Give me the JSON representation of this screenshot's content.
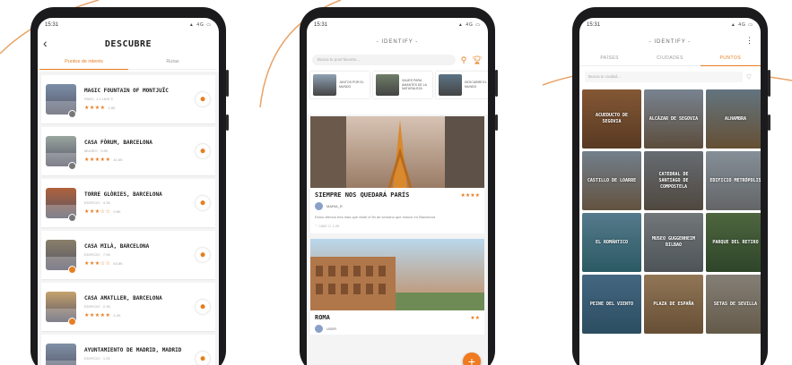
{
  "colors": {
    "accent": "#e67e22",
    "phone_body": "#1b1b1d",
    "list_bg": "#f4f4f4"
  },
  "phone1": {
    "time": "15:31",
    "status_icons": "▲ 4G ▭",
    "title": "DESCUBRE",
    "tabs": [
      {
        "label": "Puntos de interés",
        "active": true
      },
      {
        "label": "Rutas",
        "active": false
      }
    ],
    "items": [
      {
        "name": "MAGIC FOUNTAIN OF MONTJUÏC",
        "sub": "PARC, 1.2 LIKE 5",
        "stars": "★★★★",
        "count": "2.85",
        "thumb": "#7c8fa8",
        "badge": "gray"
      },
      {
        "name": "CASA FÒRUM, BARCELONA",
        "sub": "MUSEO · 9.8K",
        "stars": "★★★★★",
        "count": "41.6K",
        "thumb": "#9aa6a0",
        "badge": "gray"
      },
      {
        "name": "TORRE GLÒRIES, BARCELONA",
        "sub": "EDIFICIO · 4.3K",
        "stars": "★★★☆☆",
        "count": "9.8K",
        "thumb": "#b0623c",
        "badge": "gray"
      },
      {
        "name": "CASA MILÀ, BARCELONA",
        "sub": "EDIFICIO · 7.9K",
        "stars": "★★★☆☆",
        "count": "63.8K",
        "thumb": "#8a7f68",
        "badge": "orange"
      },
      {
        "name": "CASA AMATLLER, BARCELONA",
        "sub": "EDIFICIO · 2.3K",
        "stars": "★★★★★",
        "count": "4.2K",
        "thumb": "#c6a36e",
        "badge": "orange"
      },
      {
        "name": "AYUNTAMIENTO DE MADRID, MADRID",
        "sub": "EDIFICIO · 1.2K",
        "stars": "★★★★",
        "count": "1.1K",
        "thumb": "#7f90a6",
        "badge": "gray"
      }
    ]
  },
  "phone2": {
    "time": "15:31",
    "status_icons": "▲ 4G ▭",
    "title": "- IDENTIFY -",
    "search_placeholder": "Busca tu post favorito...",
    "search_icon": "search-icon",
    "trophy_icon": "trophy-icon",
    "cards": [
      {
        "text": "JUNTOS POR EL MUNDO",
        "color": "#8fa1b3"
      },
      {
        "text": "VIAJES PARA AMANTES DE LA NATURALEZA",
        "color": "#6f7d68"
      },
      {
        "text": "DESCUBRE EL MUNDO",
        "color": "#5d7485"
      }
    ],
    "posts": [
      {
        "title": "SIEMPRE NOS QUEDARÁ PARÍS",
        "stars": "★★★★",
        "user": "MARIA_R",
        "text": "Estos últimos tres días que visité el fin de semana que estuve en Barcelona",
        "meta": "♡ 1362   ☐ 1.2K",
        "img_top": "#d7c3b4",
        "img_bottom": "#9a7c66"
      },
      {
        "title": "ROMA",
        "stars": "★★",
        "user": "USER",
        "text": "",
        "meta": "",
        "img_top": "#b9d7ec",
        "img_bottom": "#c08a5e"
      }
    ],
    "fab_label": "+"
  },
  "phone3": {
    "time": "15:31",
    "status_icons": "▲ 4G ▭",
    "title": "- IDENTIFY -",
    "menu_icon": "kebab-menu-icon",
    "tabs": [
      {
        "label": "PAÍSES",
        "active": false
      },
      {
        "label": "CIUDADES",
        "active": false
      },
      {
        "label": "PUNTOS",
        "active": true
      }
    ],
    "search_placeholder": "Busca tu ciudad...",
    "tiles": [
      {
        "label": "ACUEDUCTO DE SEGOVIA",
        "c1": "#b77a4a",
        "c2": "#7a5030"
      },
      {
        "label": "ALCÁZAR DE SEGOVIA",
        "c1": "#a7b6c8",
        "c2": "#7f6a52"
      },
      {
        "label": "ALHAMBRA",
        "c1": "#8aa1b0",
        "c2": "#8b6f48"
      },
      {
        "label": "CASTILLO DE LOARRE",
        "c1": "#9eb0c2",
        "c2": "#8a7358"
      },
      {
        "label": "CATEDRAL DE SANTIAGO DE COMPOSTELA",
        "c1": "#8e969e",
        "c2": "#6e6458"
      },
      {
        "label": "EDIFICIO METRÓPOLIS",
        "c1": "#b9c6d2",
        "c2": "#8a8d8f"
      },
      {
        "label": "EL ROMÁNTICO",
        "c1": "#77a9c2",
        "c2": "#3c7d8a"
      },
      {
        "label": "MUSEO GUGGENHEIM BILBAO",
        "c1": "#9ea5a8",
        "c2": "#6c757a"
      },
      {
        "label": "PARQUE DEL RETIRO",
        "c1": "#6d8e57",
        "c2": "#40603a"
      },
      {
        "label": "PEINE DEL VIENTO",
        "c1": "#5f8fb3",
        "c2": "#3e6c86"
      },
      {
        "label": "PLAZA DE ESPAÑA",
        "c1": "#c9a477",
        "c2": "#8f6e4b"
      },
      {
        "label": "SETAS DE SEVILLA",
        "c1": "#b7b0a4",
        "c2": "#8c7d66"
      }
    ]
  }
}
